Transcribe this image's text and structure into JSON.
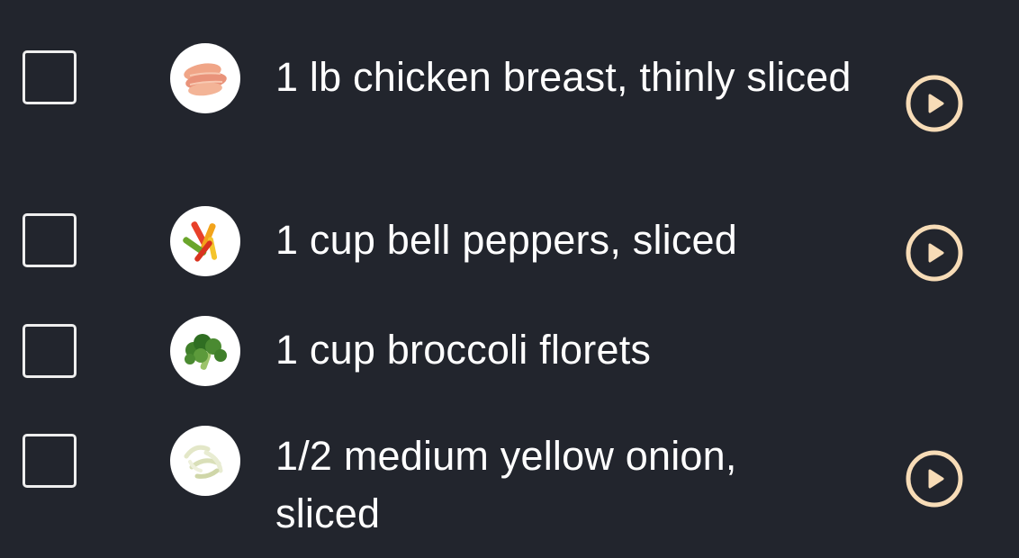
{
  "colors": {
    "background": "#22252d",
    "text": "#ffffff",
    "checkbox_border": "#eeeeee",
    "play_accent": "#f7dcb7"
  },
  "ingredients": [
    {
      "text": "1 lb chicken breast, thinly sliced",
      "checked": false,
      "image": "chicken-breast-icon",
      "has_play": true
    },
    {
      "text": "1 cup bell peppers, sliced",
      "checked": false,
      "image": "bell-peppers-icon",
      "has_play": true
    },
    {
      "text": "1 cup broccoli florets",
      "checked": false,
      "image": "broccoli-icon",
      "has_play": false
    },
    {
      "text": "1/2 medium yellow onion, sliced",
      "checked": false,
      "image": "onion-icon",
      "has_play": true
    }
  ],
  "play_icon": "play-circle-icon"
}
